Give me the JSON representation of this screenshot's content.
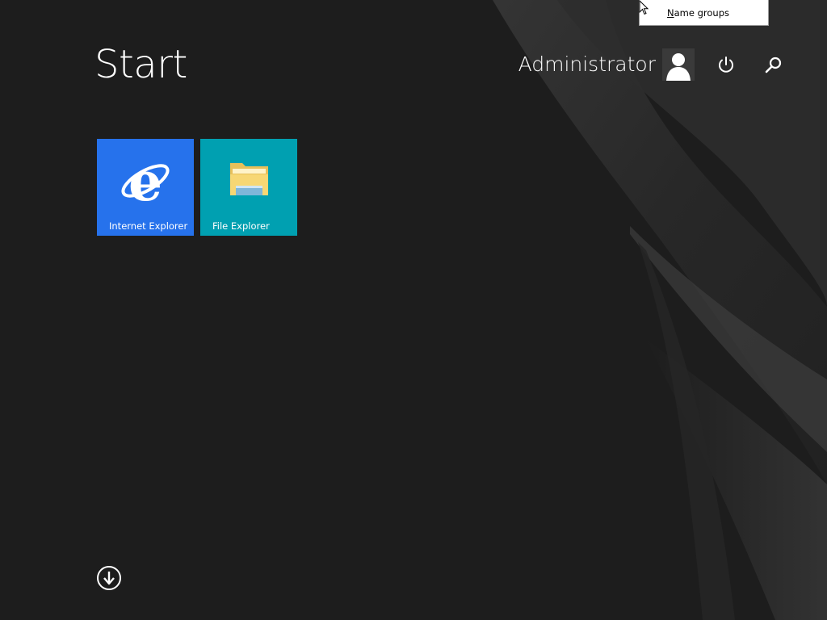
{
  "start_screen": {
    "title": "Start",
    "user_name": "Administrator",
    "icons": {
      "avatar": "user-avatar-icon",
      "power": "power-icon",
      "search": "search-icon",
      "all_apps": "down-arrow-circle-icon"
    }
  },
  "tiles": [
    {
      "label": "Internet Explorer",
      "color": "#2672ec",
      "icon": "internet-explorer-icon"
    },
    {
      "label": "File Explorer",
      "color": "#00a0b1",
      "icon": "folder-icon"
    }
  ],
  "context_menu": {
    "items": [
      {
        "mnemonic": "N",
        "rest": "ame groups"
      }
    ]
  },
  "colors": {
    "background": "#1d1d1d",
    "text": "#ffffff"
  }
}
